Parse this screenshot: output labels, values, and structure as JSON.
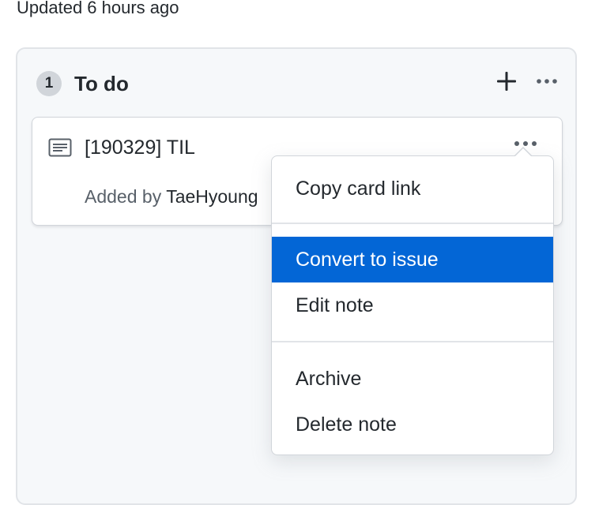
{
  "header": {
    "updated_text": "Updated 6 hours ago"
  },
  "column": {
    "count": "1",
    "title": "To do",
    "add_icon": "plus-icon",
    "more_icon": "kebab-horizontal-icon"
  },
  "card": {
    "icon": "note-icon",
    "title": "[190329] TIL",
    "added_prefix": "Added by",
    "author": "TaeHyoung",
    "more_icon": "kebab-horizontal-icon"
  },
  "menu": {
    "items": [
      {
        "label": "Copy card link"
      },
      {
        "label": "Convert to issue",
        "active": true
      },
      {
        "label": "Edit note"
      },
      {
        "label": "Archive"
      },
      {
        "label": "Delete note"
      }
    ]
  },
  "colors": {
    "accent": "#0366d6",
    "text": "#24292e",
    "muted": "#586069",
    "column_bg": "#f6f8fa"
  }
}
